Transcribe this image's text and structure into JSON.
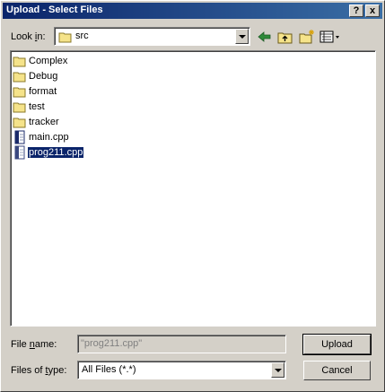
{
  "dialog": {
    "title": "Upload - Select Files",
    "help_button": "?",
    "close_button": "x"
  },
  "look_in": {
    "label_prefix": "Look ",
    "label_accel": "i",
    "label_suffix": "n:",
    "value": "src",
    "icon": "folder-icon"
  },
  "toolbar": {
    "back_icon": "back-arrow-icon",
    "up_icon": "up-folder-icon",
    "new_folder_icon": "new-folder-icon",
    "view_icon": "view-menu-icon"
  },
  "files": [
    {
      "name": "Complex",
      "type": "folder",
      "selected": false
    },
    {
      "name": "Debug",
      "type": "folder",
      "selected": false
    },
    {
      "name": "format",
      "type": "folder",
      "selected": false
    },
    {
      "name": "test",
      "type": "folder",
      "selected": false
    },
    {
      "name": "tracker",
      "type": "folder",
      "selected": false
    },
    {
      "name": "main.cpp",
      "type": "file",
      "selected": false
    },
    {
      "name": "prog211.cpp",
      "type": "file",
      "selected": true
    }
  ],
  "file_name": {
    "label_prefix": "File ",
    "label_accel": "n",
    "label_suffix": "ame:",
    "value": "\"prog211.cpp\""
  },
  "file_type": {
    "label_prefix": "Files of ",
    "label_accel": "t",
    "label_suffix": "ype:",
    "value": "All Files (*.*)"
  },
  "buttons": {
    "upload": "Upload",
    "cancel": "Cancel"
  }
}
